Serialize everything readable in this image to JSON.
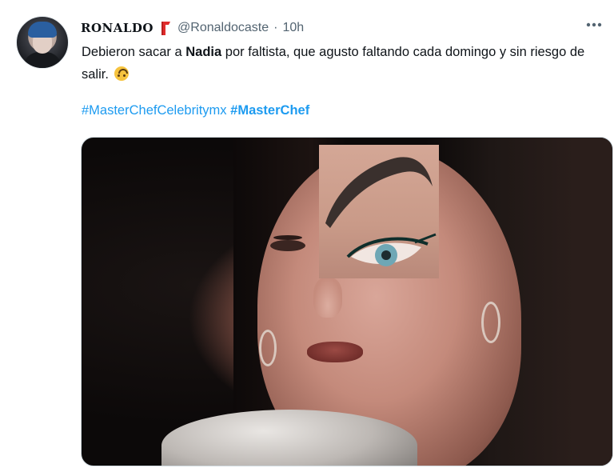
{
  "tweet": {
    "display_name": "RONALDO",
    "handle": "@Ronaldocaste",
    "separator": "·",
    "time": "10h",
    "text_part1": "Debieron sacar a ",
    "text_bold": "Nadia",
    "text_part2": " por faltista, que agusto faltando cada domingo y sin riesgo de salir.",
    "hashtags": [
      "#MasterChefCelebritymx",
      "#MasterChef"
    ],
    "more_icon": "more-horizontal-icon",
    "badge_icon": "flag-icon",
    "emoji_icon": "upside-down-face-icon"
  },
  "colors": {
    "link": "#1d9bf0",
    "text": "#0f1419",
    "muted": "#536471",
    "flag": "#e02b2b"
  }
}
